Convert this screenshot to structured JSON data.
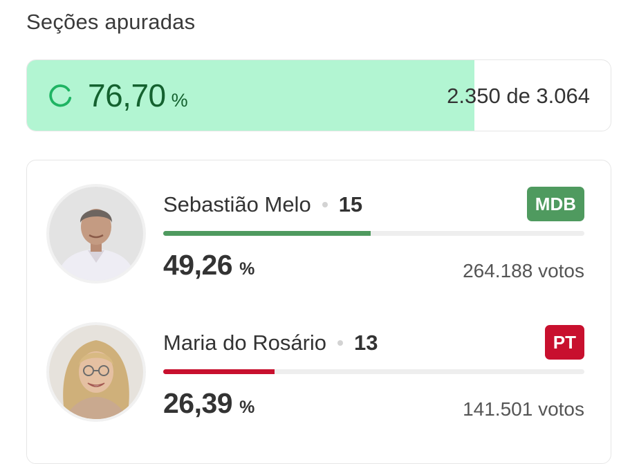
{
  "section_title": "Seções apuradas",
  "apuracao": {
    "percent_text": "76,70",
    "percent_sign": "%",
    "progress_fraction": 0.767,
    "sections_text": "2.350 de 3.064",
    "fill_color": "#b2f5d2",
    "text_color": "#14612f"
  },
  "candidates": [
    {
      "name": "Sebastião Melo",
      "number": "15",
      "party": "MDB",
      "party_color": "#4f9a5f",
      "percent_text": "49,26",
      "percent_sign": "%",
      "percent_value": 49.26,
      "bar_color": "#4f9a5f",
      "votes_text": "264.188 votos",
      "avatar": "candidate-photo-icon"
    },
    {
      "name": "Maria do Rosário",
      "number": "13",
      "party": "PT",
      "party_color": "#c8102e",
      "percent_text": "26,39",
      "percent_sign": "%",
      "percent_value": 26.39,
      "bar_color": "#c8102e",
      "votes_text": "141.501 votos",
      "avatar": "candidate-photo-icon"
    }
  ]
}
